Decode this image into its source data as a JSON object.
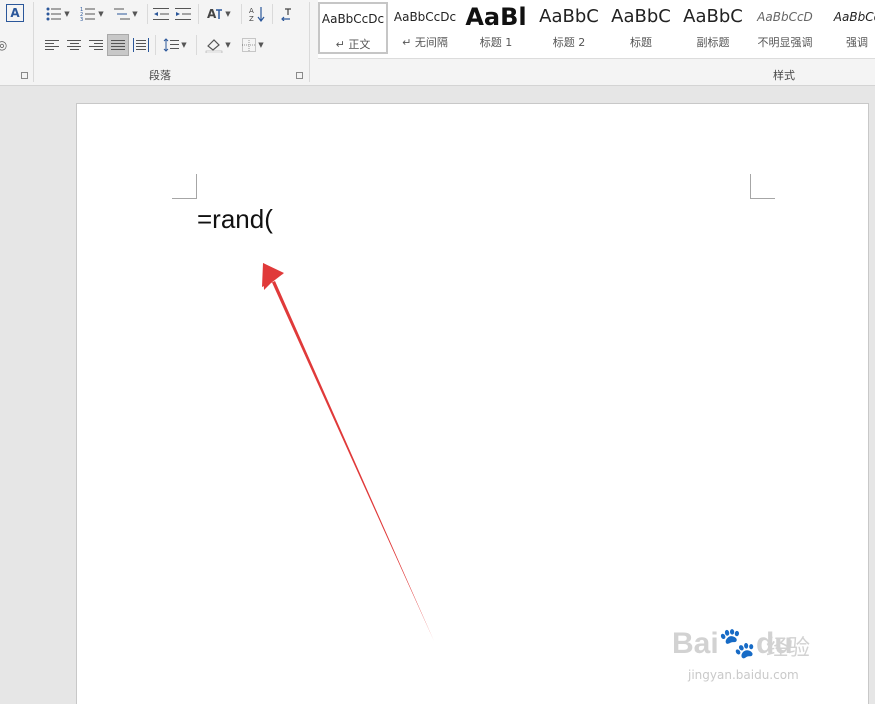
{
  "paragraph_group": {
    "label": "段落",
    "row1": [
      {
        "name": "bullets",
        "icon": "bullet-list-icon"
      },
      {
        "name": "numbering",
        "icon": "numbered-list-icon"
      },
      {
        "name": "multilevel",
        "icon": "multilevel-list-icon"
      },
      {
        "name": "decrease-indent",
        "icon": "decrease-indent-icon"
      },
      {
        "name": "increase-indent",
        "icon": "increase-indent-icon"
      },
      {
        "name": "chinese-layout",
        "icon": "chinese-layout-icon"
      },
      {
        "name": "sort",
        "icon": "sort-icon"
      },
      {
        "name": "show-marks",
        "icon": "pilcrow-icon"
      }
    ],
    "row2": [
      {
        "name": "align-left",
        "icon": "align-left-icon"
      },
      {
        "name": "align-center",
        "icon": "align-center-icon"
      },
      {
        "name": "align-right",
        "icon": "align-right-icon"
      },
      {
        "name": "justify",
        "icon": "justify-icon",
        "active": true
      },
      {
        "name": "distributed",
        "icon": "distributed-icon"
      },
      {
        "name": "line-spacing",
        "icon": "line-spacing-icon"
      },
      {
        "name": "shading",
        "icon": "shading-icon"
      },
      {
        "name": "borders",
        "icon": "borders-icon"
      }
    ]
  },
  "font_group": {
    "text_effect_glyph": "A",
    "clear_glyph": "◎"
  },
  "styles_group": {
    "label": "样式",
    "items": [
      {
        "preview": "AaBbCcDc",
        "name": "↵ 正文",
        "selected": true
      },
      {
        "preview": "AaBbCcDc",
        "name": "↵ 无间隔"
      },
      {
        "preview": "AaBl",
        "name": "标题 1"
      },
      {
        "preview": "AaBbC",
        "name": "标题 2"
      },
      {
        "preview": "AaBbC",
        "name": "标题"
      },
      {
        "preview": "AaBbC",
        "name": "副标题"
      },
      {
        "preview": "AaBbCcD",
        "name": "不明显强调"
      },
      {
        "preview": "AaBbCc",
        "name": "强调"
      }
    ]
  },
  "document": {
    "text": "=rand("
  },
  "watermark": {
    "logo": "Bai🐾du",
    "logo_cn": "经验",
    "sub": "jingyan.baidu.com"
  },
  "colors": {
    "arrow": "#e03a3a",
    "ribbon": "#f4f4f4",
    "workspace": "#e6e6e6"
  }
}
